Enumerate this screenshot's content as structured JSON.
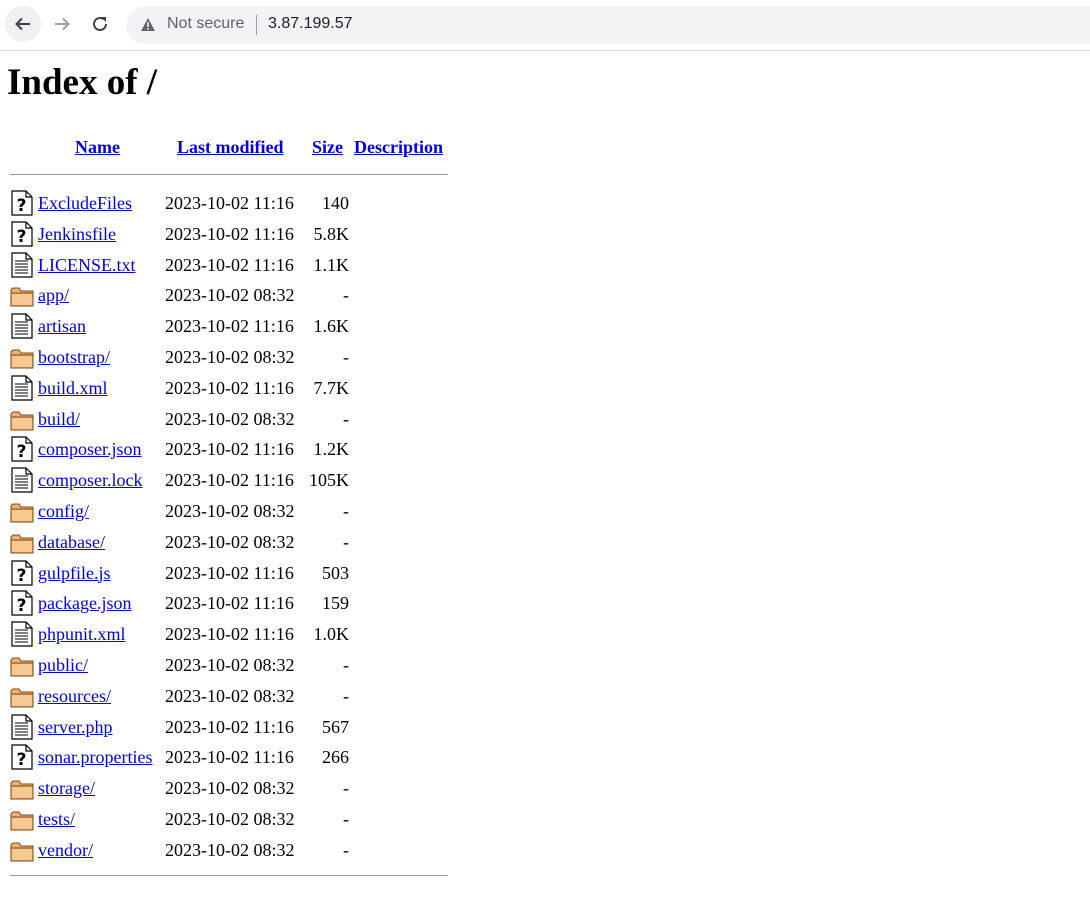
{
  "browser": {
    "security_label": "Not secure",
    "url": "3.87.199.57"
  },
  "page": {
    "title": "Index of /",
    "headers": {
      "name": "Name",
      "last_modified": "Last modified",
      "size": "Size",
      "description": "Description"
    },
    "entries": [
      {
        "name": "ExcludeFiles",
        "modified": "2023-10-02 11:16",
        "size": "140",
        "icon": "unknown-file-icon"
      },
      {
        "name": "Jenkinsfile",
        "modified": "2023-10-02 11:16",
        "size": "5.8K",
        "icon": "unknown-file-icon"
      },
      {
        "name": "LICENSE.txt",
        "modified": "2023-10-02 11:16",
        "size": "1.1K",
        "icon": "text-file-icon"
      },
      {
        "name": "app/",
        "modified": "2023-10-02 08:32",
        "size": "-",
        "icon": "folder-icon"
      },
      {
        "name": "artisan",
        "modified": "2023-10-02 11:16",
        "size": "1.6K",
        "icon": "text-file-icon"
      },
      {
        "name": "bootstrap/",
        "modified": "2023-10-02 08:32",
        "size": "-",
        "icon": "folder-icon"
      },
      {
        "name": "build.xml",
        "modified": "2023-10-02 11:16",
        "size": "7.7K",
        "icon": "text-file-icon"
      },
      {
        "name": "build/",
        "modified": "2023-10-02 08:32",
        "size": "-",
        "icon": "folder-icon"
      },
      {
        "name": "composer.json",
        "modified": "2023-10-02 11:16",
        "size": "1.2K",
        "icon": "unknown-file-icon"
      },
      {
        "name": "composer.lock",
        "modified": "2023-10-02 11:16",
        "size": "105K",
        "icon": "text-file-icon"
      },
      {
        "name": "config/",
        "modified": "2023-10-02 08:32",
        "size": "-",
        "icon": "folder-icon"
      },
      {
        "name": "database/",
        "modified": "2023-10-02 08:32",
        "size": "-",
        "icon": "folder-icon"
      },
      {
        "name": "gulpfile.js",
        "modified": "2023-10-02 11:16",
        "size": "503",
        "icon": "unknown-file-icon"
      },
      {
        "name": "package.json",
        "modified": "2023-10-02 11:16",
        "size": "159",
        "icon": "unknown-file-icon"
      },
      {
        "name": "phpunit.xml",
        "modified": "2023-10-02 11:16",
        "size": "1.0K",
        "icon": "text-file-icon"
      },
      {
        "name": "public/",
        "modified": "2023-10-02 08:32",
        "size": "-",
        "icon": "folder-icon"
      },
      {
        "name": "resources/",
        "modified": "2023-10-02 08:32",
        "size": "-",
        "icon": "folder-icon"
      },
      {
        "name": "server.php",
        "modified": "2023-10-02 11:16",
        "size": "567",
        "icon": "text-file-icon"
      },
      {
        "name": "sonar.properties",
        "modified": "2023-10-02 11:16",
        "size": "266",
        "icon": "unknown-file-icon"
      },
      {
        "name": "storage/",
        "modified": "2023-10-02 08:32",
        "size": "-",
        "icon": "folder-icon"
      },
      {
        "name": "tests/",
        "modified": "2023-10-02 08:32",
        "size": "-",
        "icon": "folder-icon"
      },
      {
        "name": "vendor/",
        "modified": "2023-10-02 08:32",
        "size": "-",
        "icon": "folder-icon"
      }
    ]
  },
  "colors": {
    "link": "#0000ee",
    "folder_fill": "#f0b070",
    "chrome_bg": "#f1f3f4"
  }
}
